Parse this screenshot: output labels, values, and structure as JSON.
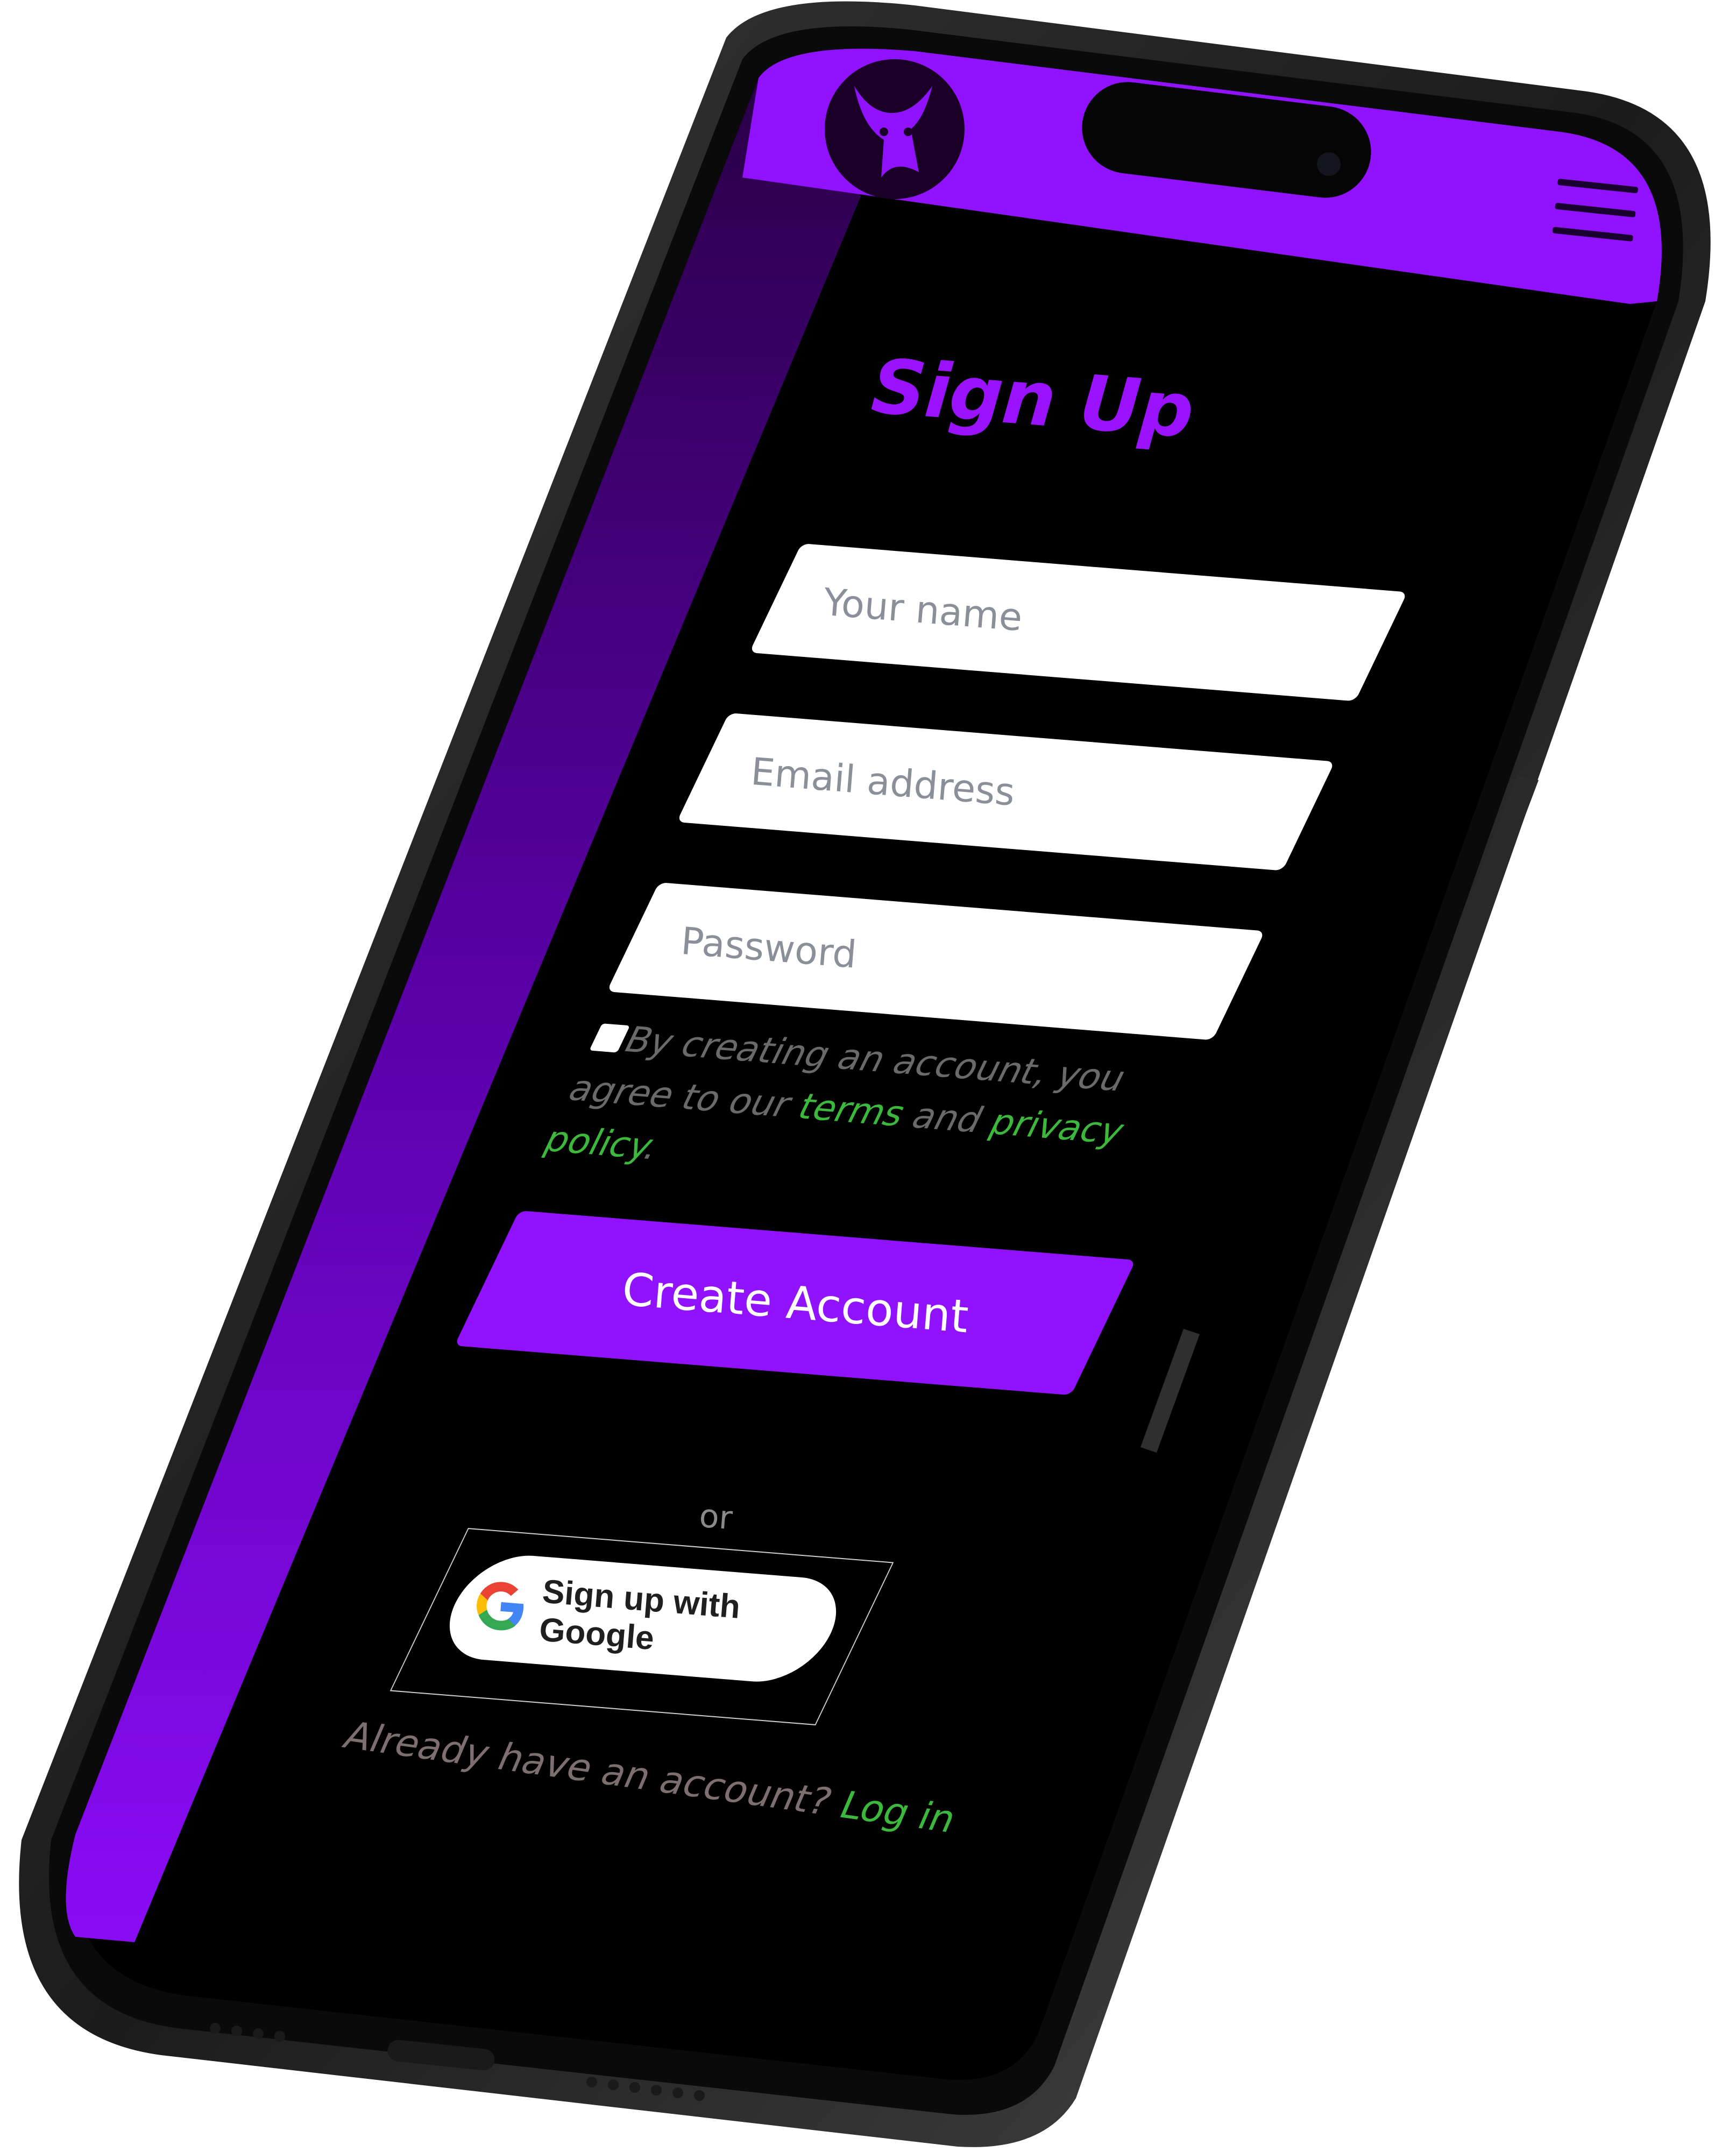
{
  "signup": {
    "title": "Sign Up",
    "name_placeholder": "Your name",
    "email_placeholder": "Email address",
    "password_placeholder": "Password",
    "agree_prefix": "By creating an account, you agree to our",
    "terms_link": "terms",
    "and_text": "and",
    "privacy_link": "privacy policy",
    "period": ".",
    "create_button": "Create Account",
    "or_text": "or",
    "google_button": "Sign up with Google",
    "already_text": "Already have an account?",
    "login_link": "Log in"
  },
  "header": {
    "logo_icon": "bull-logo-icon",
    "menu_icon": "hamburger-menu-icon"
  },
  "colors": {
    "brand_purple": "#9112ff",
    "link_green": "#3cb83c",
    "screen_bg": "#000000"
  }
}
